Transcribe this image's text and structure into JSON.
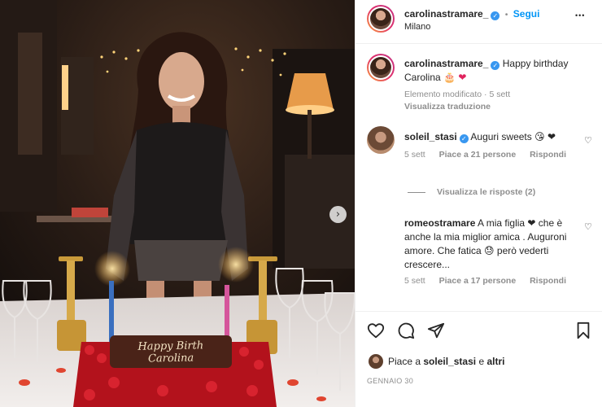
{
  "header": {
    "username": "carolinastramare_",
    "follow_label": "Segui",
    "location": "Milano",
    "separator": "•",
    "more_label": "•••"
  },
  "caption": {
    "username": "carolinastramare_",
    "text": "Happy birthday Carolina",
    "emojis": "🎂 ❤",
    "meta": "Elemento modificato · 5 sett",
    "translate_label": "Visualizza traduzione"
  },
  "comments": [
    {
      "username": "soleil_stasi",
      "text": "Auguri sweets 😘 ❤",
      "time": "5 sett",
      "likes": "Piace a 21 persone",
      "reply_label": "Rispondi"
    },
    {
      "username": "romeostramare",
      "text": "A mia figlia ❤ che è anche la mia miglior amica . Auguroni amore. Che fatica 😓 però vederti crescere...",
      "time": "5 sett",
      "likes": "Piace a 17 persone",
      "reply_label": "Rispondi"
    }
  ],
  "replies_toggle": "Visualizza le risposte (2)",
  "likes_line": {
    "prefix": "Piace a",
    "user": "soleil_stasi",
    "middle": "e",
    "suffix": "altri"
  },
  "date": "GENNAIO 30",
  "photo": {
    "cake_text_line1": "Happy Birth",
    "cake_text_line2": "Carolina"
  },
  "icons": {
    "heart": "heart-icon",
    "comment": "comment-icon",
    "share": "share-icon",
    "save": "bookmark-icon",
    "next": "chevron-right-icon"
  },
  "colors": {
    "accent": "#0095f6",
    "verified": "#3897f0",
    "muted": "#8e8e8e"
  }
}
